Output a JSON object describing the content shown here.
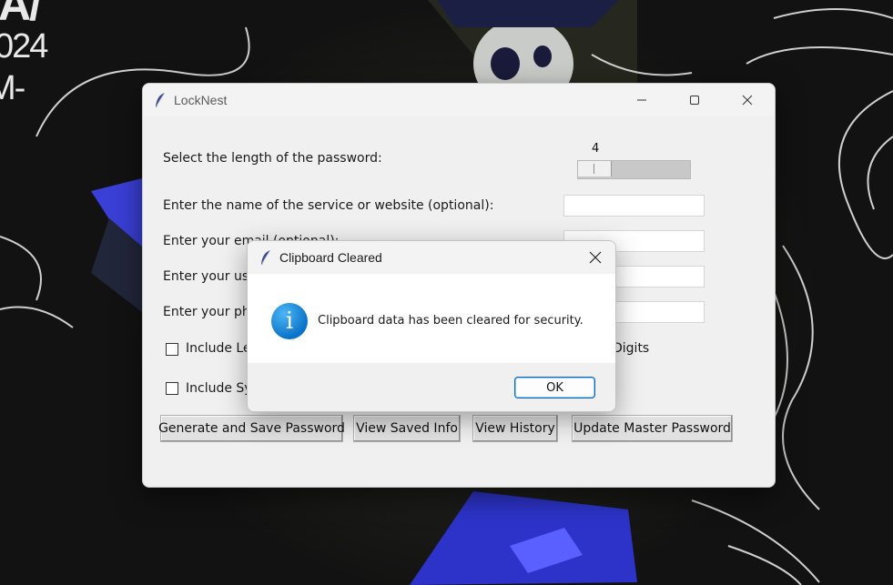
{
  "desktop": {
    "wallpaper_text": [
      "A/",
      "024",
      "M-"
    ]
  },
  "main_window": {
    "title": "LockNest",
    "length_label": "Select the length of the password:",
    "length_value": "4",
    "service_label": "Enter the name of the service or website (optional):",
    "email_label": "Enter your email (optional):",
    "username_label": "Enter your use",
    "phone_label": "Enter your pho",
    "include_letters_label": "Include Le",
    "include_digits_label": "Digits",
    "include_symbols_label": "Include Sy",
    "buttons": {
      "generate": "Generate and Save Password",
      "view_saved": "View Saved Info",
      "view_history": "View History",
      "update_master": "Update Master Password"
    }
  },
  "dialog": {
    "title": "Clipboard Cleared",
    "message": "Clipboard data has been cleared for security.",
    "ok": "OK",
    "info_glyph": "i"
  },
  "colors": {
    "dialog_accent": "#0067c0",
    "info_icon": "#0a73c9"
  }
}
